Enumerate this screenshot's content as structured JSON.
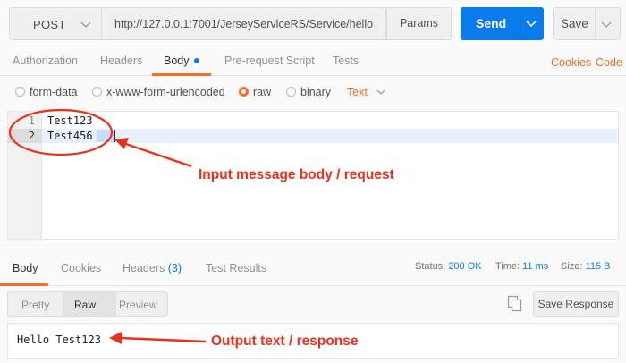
{
  "request": {
    "method": "POST",
    "url": "http://127.0.0.1:7001/JerseyServiceRS/Service/hello",
    "params_label": "Params",
    "send_label": "Send",
    "save_label": "Save"
  },
  "request_tabs": {
    "items": [
      "Authorization",
      "Headers",
      "Body",
      "Pre-request Script",
      "Tests"
    ],
    "active": "Body",
    "cookies_label": "Cookies",
    "code_label": "Code"
  },
  "body_types": {
    "items": [
      "form-data",
      "x-www-form-urlencoded",
      "raw",
      "binary"
    ],
    "selected": "raw",
    "content_type": "Text"
  },
  "editor": {
    "line_numbers": [
      "1",
      "2"
    ],
    "lines": [
      "Test123",
      "Test4",
      "56"
    ]
  },
  "response_tabs": {
    "items": [
      "Body",
      "Cookies",
      "Headers",
      "Test Results"
    ],
    "headers_count": "(3)",
    "active": "Body"
  },
  "response_meta": {
    "status_label": "Status:",
    "status_value": "200 OK",
    "time_label": "Time:",
    "time_value": "11 ms",
    "size_label": "Size:",
    "size_value": "115 B"
  },
  "format": {
    "items": [
      "Pretty",
      "Raw",
      "Preview"
    ],
    "active": "Raw",
    "save_response_label": "Save Response"
  },
  "response_body": "Hello Test123",
  "annotations": {
    "input": "Input message body / request",
    "output": "Output text / response"
  },
  "colors": {
    "accent_orange": "#f47023",
    "send_blue": "#097bed",
    "annotation_red": "#e8321c"
  }
}
